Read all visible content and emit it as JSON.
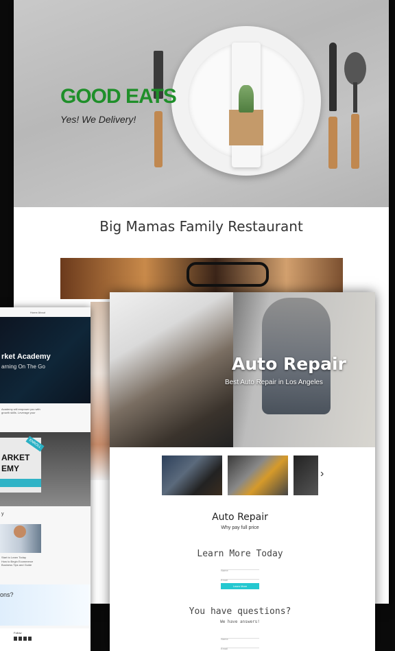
{
  "restaurant": {
    "brand": "GOOD EATS",
    "tagline": "Yes! We Delivery!",
    "title": "Big Mamas Family Restaurant"
  },
  "academy": {
    "nav": "Home  About",
    "hero_title": "rket Academy",
    "hero_sub": "arning On The Go",
    "intro": "Academy will empower you with growth skills. Leverage your",
    "promo_line1": "ARKET",
    "promo_line2": "EMY",
    "promo_ribbon": "ENROLL",
    "course_caption": "Start to Learn Today",
    "course_desc": "How to Begin Ecommerce Business Tips and Guide",
    "section_label": "y",
    "bottom_heading": "ons?",
    "footer_label": "Follow"
  },
  "auto": {
    "hero_title": "Auto Repair",
    "hero_sub": "Best Auto Repair in Los Angeles",
    "next_arrow": "›",
    "title": "Auto Repair",
    "subtitle": "Why pay full price",
    "cta_heading": "Learn More Today",
    "field_name": "Name",
    "field_email": "Email",
    "submit": "Learn More",
    "q_heading": "You have questions?",
    "q_sub": "We have answers!",
    "q_field1": "Name",
    "q_field2": "Email"
  }
}
